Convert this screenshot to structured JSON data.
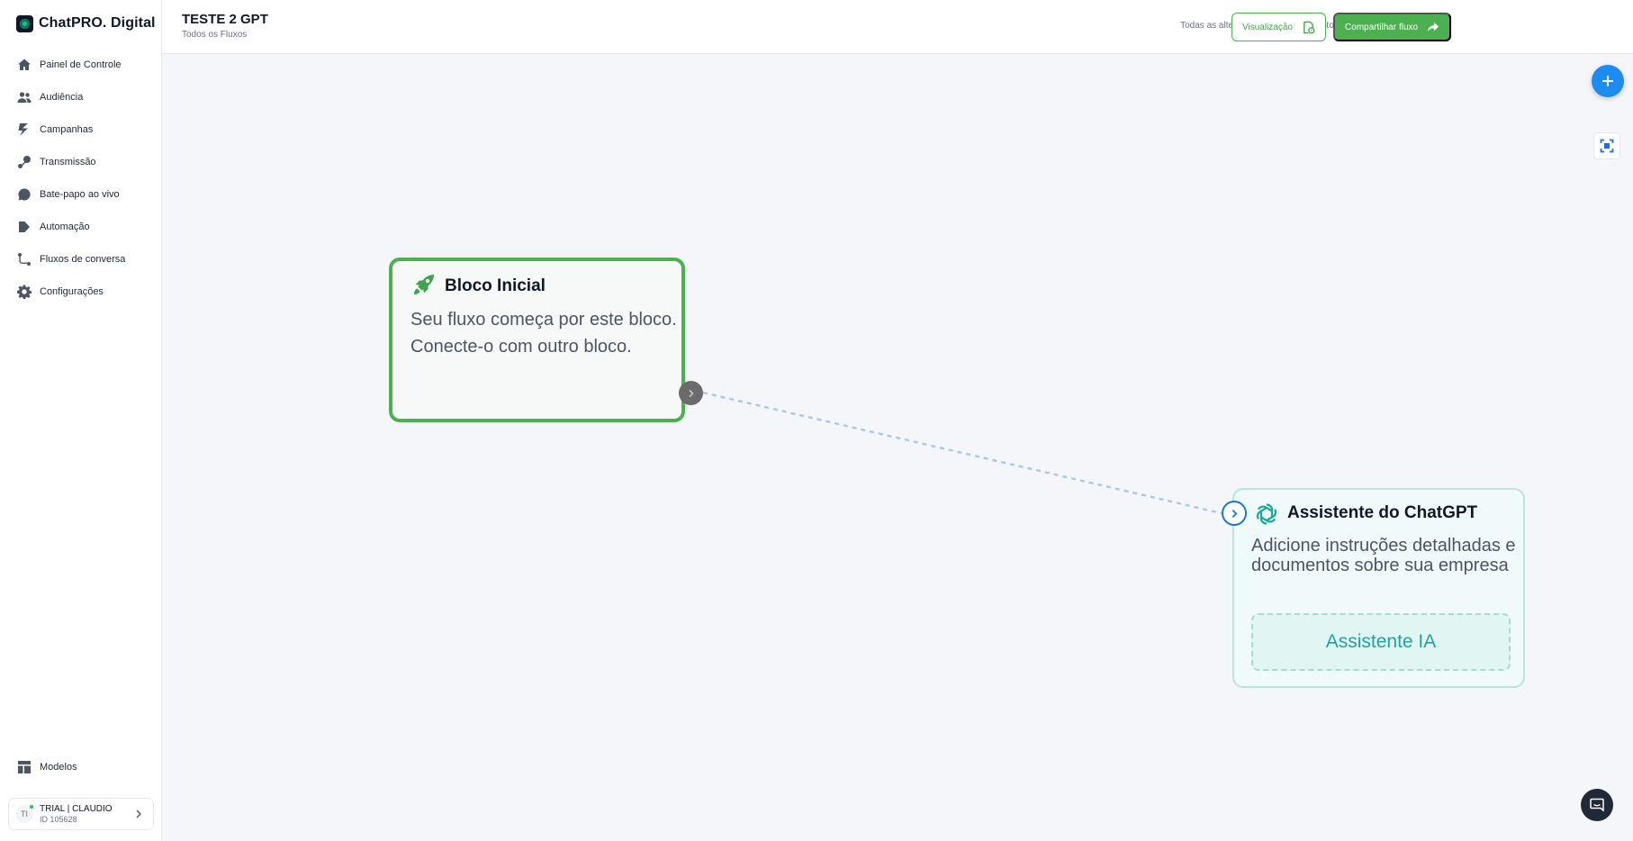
{
  "brand": {
    "name": "ChatPRO. Digital"
  },
  "sidebar": {
    "items": [
      {
        "label": "Painel de Controle",
        "icon": "home-icon"
      },
      {
        "label": "Audiência",
        "icon": "users-icon"
      },
      {
        "label": "Campanhas",
        "icon": "campaign-icon"
      },
      {
        "label": "Transmissão",
        "icon": "broadcast-icon"
      },
      {
        "label": "Bate-papo ao vivo",
        "icon": "chat-icon"
      },
      {
        "label": "Automação",
        "icon": "automation-icon"
      },
      {
        "label": "Fluxos de conversa",
        "icon": "flow-icon"
      },
      {
        "label": "Configurações",
        "icon": "gear-icon"
      }
    ],
    "models_label": "Modelos",
    "account": {
      "avatar": "TI",
      "name": "TRIAL | CLAUDIO",
      "id": "ID 105628"
    }
  },
  "header": {
    "title": "TESTE 2 GPT",
    "breadcrumb": "Todos os Fluxos",
    "autosave": "Todas as alterações foram salvas automaticamente",
    "preview_label": "Visualização",
    "share_label": "Compartilhar fluxo"
  },
  "canvas": {
    "start_node": {
      "title": "Bloco Inicial",
      "description": "Seu fluxo começa por este bloco. Conecte-o com outro bloco."
    },
    "gpt_node": {
      "title": "Assistente do ChatGPT",
      "description": "Adicione instruções detalhadas e documentos sobre sua empresa",
      "button": "Assistente IA"
    }
  },
  "colors": {
    "accent_green": "#4caf50",
    "accent_blue": "#1d8cf0",
    "gpt_teal": "#22a39b"
  }
}
